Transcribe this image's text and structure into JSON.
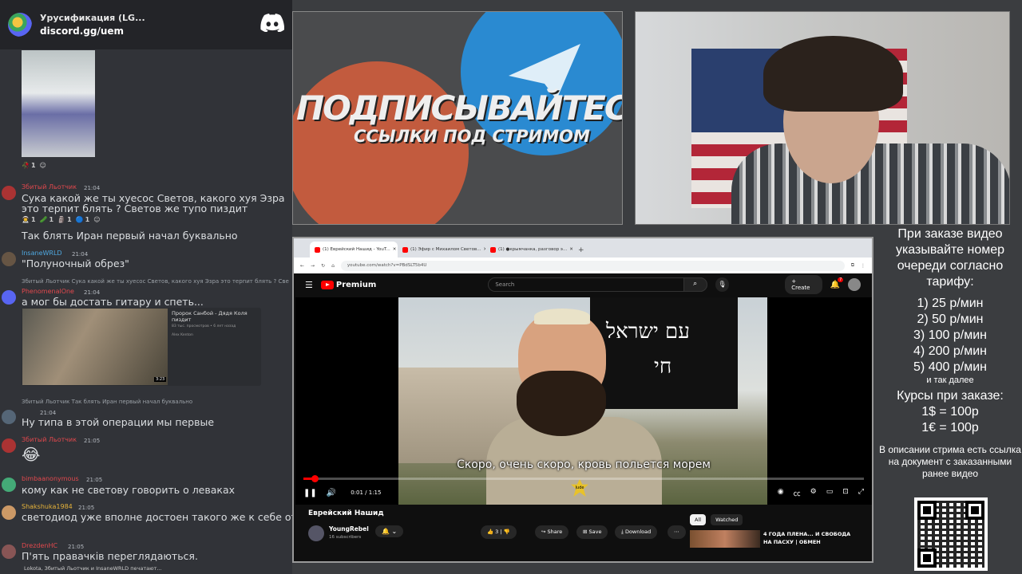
{
  "chat": {
    "server_name": "Урусификация (LG...",
    "server_link": "discord.gg/uem",
    "messages": [
      {
        "user": "Збитый Льотчик",
        "time": "21:04",
        "text": "Сука какой же ты хуесос Светов, какого хуя Эзра это терпит блять ?  Светов же тупо пиздит",
        "reactions": [
          "1",
          "1",
          "1",
          "1"
        ]
      },
      {
        "user": "",
        "time": "",
        "text": "Так блять Иран первый начал буквально"
      },
      {
        "user": "InsaneWRLD",
        "time": "21:04",
        "text": "\"Полуночный обрез\""
      },
      {
        "reply": "Збитый Льотчик  Сука какой же ты хуесос Светов, какого хуя Эзра это терпит блять ?  Светов ж...",
        "user": "PhenomenalOne",
        "time": "21:04",
        "text": "а мог бы достать гитару и спеть..."
      },
      {
        "reply": "Збитый Льотчик  Так блять Иран первый начал буквально",
        "user": "",
        "time": "21:04",
        "text": "Ну типа в этой операции мы первые"
      },
      {
        "user": "Збитый Льотчик",
        "time": "21:05",
        "text": "😂"
      },
      {
        "user": "bimbaanonymous",
        "time": "21:05",
        "text": "кому как не светову говорить о леваках"
      },
      {
        "user": "Shakshuka1984",
        "time": "21:05",
        "text": "светодиод уже вполне достоен такого же к себе отношения как Жмиль и прочий самый низкий Z сброд"
      },
      {
        "user": "DrezdenHC",
        "time": "21:05",
        "text": "П'ять правачків переглядаються."
      }
    ],
    "first_reactions": [
      "1"
    ],
    "embed": {
      "title": "Пророк Санбой - Дядя Коля пиздит",
      "meta": "83 тыс. просмотров • 6 лет назад",
      "author": "Alex Kenton",
      "duration": "3:23"
    },
    "typing": "Lokota, Збитый Льотчик и InsaneWRLD печатают..."
  },
  "promo": {
    "title": "ПОДПИСЫВАЙТЕСЬ",
    "subtitle": "ССЫЛКИ ПОД СТРИМОМ"
  },
  "rules": {
    "heading": "При заказе видео указывайте номер очереди согласно тарифу:",
    "tariffs": [
      "1) 25 р/мин",
      "2) 50 р/мин",
      "3) 100 р/мин",
      "4) 200 р/мин",
      "5) 400 р/мин"
    ],
    "etc": "и так далее",
    "rates_heading": "Курсы при заказе:",
    "rates": [
      "1$ = 100р",
      "1€ = 100р"
    ],
    "note": "В описании стрима есть ссылка на документ с заказанными ранее видео"
  },
  "browser": {
    "tabs": [
      "(1) Еврейский Нашид - YouT...",
      "(1) Эфир с Михаилом Светов...",
      "(1) ●крымчанка, разговор э..."
    ],
    "url": "youtube.com/watch?v=PBdSLT5b4U"
  },
  "youtube": {
    "logo": "Premium",
    "search_placeholder": "Search",
    "create": "Create",
    "notif_count": "7",
    "subtitle": "Скоро, очень скоро, кровь польется морем",
    "time": "0:01 / 1:15",
    "progress": 0.02,
    "video_title": "Еврейский Нашид",
    "channel": "YoungRebel",
    "subs": "16 subscribers",
    "likes": "3",
    "share": "Share",
    "save": "Save",
    "download": "Download",
    "chips": [
      "All",
      "Watched"
    ],
    "rec_title": "4 ГОДА ПЛЕНА... И СВОБОДА НА ПАСХУ | ОБМЕН",
    "banner_line1": "עם ישראל",
    "banner_line2": "חי",
    "badge": "Jude"
  }
}
